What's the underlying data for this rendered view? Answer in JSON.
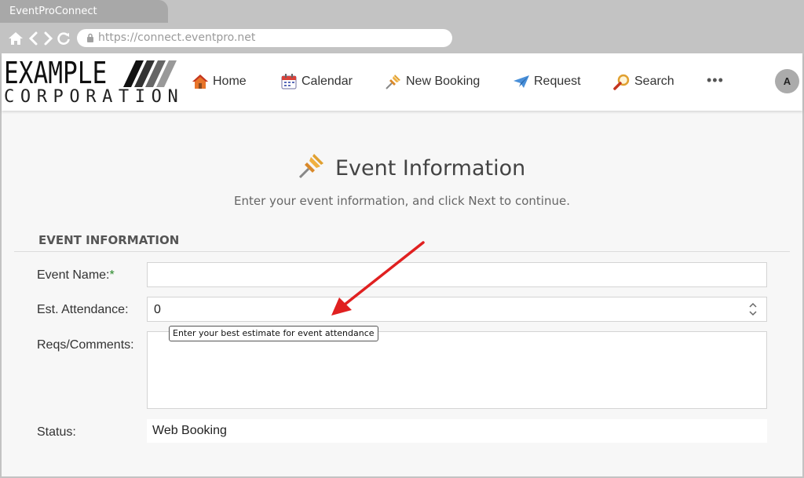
{
  "browser": {
    "tab_title": "EventProConnect",
    "url": "https://connect.eventpro.net"
  },
  "brand": {
    "logo_top": "EXAMPLE",
    "logo_bottom": "CORPORATION"
  },
  "nav": {
    "items": [
      {
        "label": "Home",
        "icon": "house-icon"
      },
      {
        "label": "Calendar",
        "icon": "calendar-icon"
      },
      {
        "label": "New Booking",
        "icon": "pushpin-icon"
      },
      {
        "label": "Request",
        "icon": "paper-plane-icon"
      },
      {
        "label": "Search",
        "icon": "magnifier-icon"
      }
    ],
    "more_label": "•••",
    "avatar_initial": "A"
  },
  "page": {
    "title": "Event Information",
    "subtitle": "Enter your event information, and click Next to continue.",
    "section_title": "EVENT INFORMATION"
  },
  "form": {
    "event_name_label": "Event Name:",
    "required_mark": "*",
    "event_name_value": "",
    "attendance_label": "Est. Attendance:",
    "attendance_value": "0",
    "attendance_tooltip": "Enter your best estimate for event attendance",
    "comments_label": "Reqs/Comments:",
    "comments_value": "",
    "status_label": "Status:",
    "status_value": "Web Booking"
  },
  "colors": {
    "chrome": "#c3c3c3",
    "content_bg": "#f7f7f7",
    "annotation_arrow": "#e02020",
    "required": "#2a8a2a"
  }
}
